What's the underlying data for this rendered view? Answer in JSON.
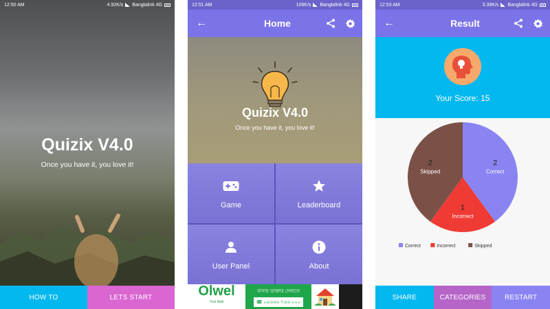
{
  "colors": {
    "primary": "#7b73e8",
    "cyan": "#03b8ee",
    "pink": "#d966d1",
    "correct": "#8a84f2",
    "incorrect": "#ef3b34",
    "skipped": "#7b5147"
  },
  "splash": {
    "status_time": "12:50 AM",
    "status_speed": "4.92K/s",
    "status_carrier": "Banglalink 4G",
    "title": "Quizix V4.0",
    "tagline": "Once you have it, you love it!",
    "howto_button": "HOW TO",
    "start_button": "LETS START"
  },
  "home": {
    "status_time": "12:51 AM",
    "status_speed": "109K/s",
    "status_carrier": "Banglalink 4G",
    "toolbar_title": "Home",
    "title": "Quizix V4.0",
    "tagline": "Once you have it, you love it!",
    "tiles": [
      {
        "label": "Game",
        "icon": "gamepad-icon"
      },
      {
        "label": "Leaderboard",
        "icon": "star-icon"
      },
      {
        "label": "User Panel",
        "icon": "person-icon"
      },
      {
        "label": "About",
        "icon": "info-icon"
      }
    ],
    "ad": {
      "brand": "Olwel",
      "brand_sub": "Tool Wall",
      "headline": "বাসায় ডাক্তার দেখাতে",
      "phone": "☎ ০৯৬৬৬ ৭৬৬ ০০০"
    }
  },
  "result": {
    "status_time": "12:53 AM",
    "status_speed": "3.39K/s",
    "status_carrier": "Banglalink 4G",
    "toolbar_title": "Result",
    "score_text": "Your Score: 15",
    "share_button": "SHARE",
    "categories_button": "CATEGORIES",
    "restart_button": "RESTART"
  },
  "chart_data": {
    "type": "pie",
    "slices": [
      {
        "label": "Correct",
        "value": 2
      },
      {
        "label": "Incorrect",
        "value": 1
      },
      {
        "label": "Skipped",
        "value": 2
      }
    ],
    "legend": [
      "Correct",
      "Incorrect",
      "Skipped"
    ],
    "legend_position": "bottom"
  }
}
